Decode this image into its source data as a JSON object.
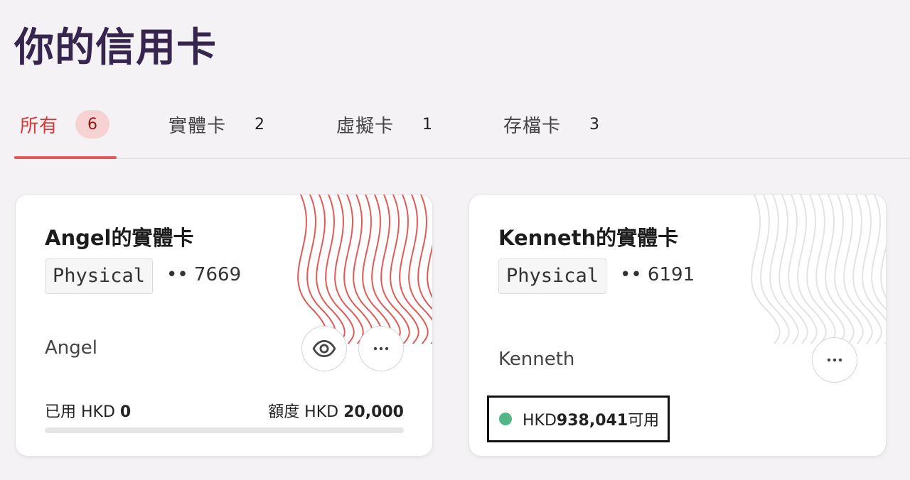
{
  "page": {
    "title": "你的信用卡"
  },
  "tabs": [
    {
      "label": "所有",
      "count": "6"
    },
    {
      "label": "實體卡",
      "count": "2"
    },
    {
      "label": "虛擬卡",
      "count": "1"
    },
    {
      "label": "存檔卡",
      "count": "3"
    }
  ],
  "active_tab_index": 0,
  "cards": [
    {
      "title": "Angel的實體卡",
      "type": "Physical",
      "number": "•• 7669",
      "holder": "Angel",
      "used_label": "已用 HKD ",
      "used_value": "0",
      "limit_label": "額度 HKD ",
      "limit_value": "20,000",
      "used_fraction": 0,
      "pattern_color": "#e05b57"
    },
    {
      "title": "Kenneth的實體卡",
      "type": "Physical",
      "number": "•• 6191",
      "holder": "Kenneth",
      "available_prefix": "HKD",
      "available_value": "938,041",
      "available_suffix": "可用",
      "status_color": "#52b686",
      "pattern_color": "#e3e3e3"
    }
  ],
  "colors": {
    "accent": "#d5393a",
    "title": "#35254f"
  },
  "icons": {
    "view": "eye-icon",
    "more": "more-horizontal-icon"
  }
}
